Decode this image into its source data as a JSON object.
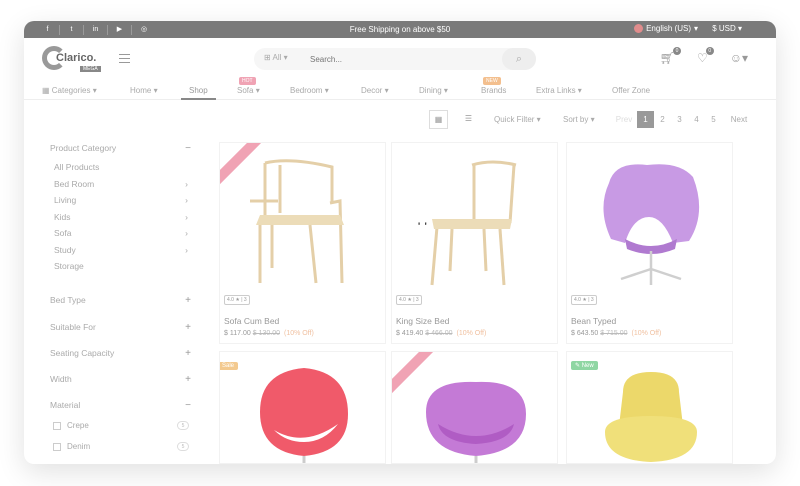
{
  "topbar": {
    "social": [
      "f",
      "t",
      "in",
      "▶",
      "◎"
    ],
    "shipping": "Free Shipping on above $50",
    "language": "English (US)",
    "currency": "$ USD"
  },
  "header": {
    "logo_text": "Clarico.",
    "logo_badge": "MEGA",
    "search_category": "All",
    "search_placeholder": "Search...",
    "cart_count": "0",
    "wishlist_count": "0"
  },
  "nav": {
    "categories": "Categories",
    "home": "Home",
    "shop": "Shop",
    "sofa": "Sofa",
    "sofa_tag": "HOT",
    "bedroom": "Bedroom",
    "decor": "Decor",
    "dining": "Dining",
    "brands": "Brands",
    "brands_tag": "NEW",
    "extra_links": "Extra Links",
    "offer_zone": "Offer Zone"
  },
  "sidebar": {
    "product_category": "Product Category",
    "categories": [
      "All Products",
      "Bed Room",
      "Living",
      "Kids",
      "Sofa",
      "Study",
      "Storage"
    ],
    "filters": [
      "Bed Type",
      "Suitable For",
      "Seating Capacity",
      "Width",
      "Material"
    ],
    "materials": [
      {
        "label": "Crepe",
        "count": "5"
      },
      {
        "label": "Denim",
        "count": "5"
      }
    ]
  },
  "toolbar": {
    "quick_filter": "Quick Filter",
    "sort_by": "Sort by",
    "prev": "Prev",
    "pages": [
      "1",
      "2",
      "3",
      "4",
      "5"
    ],
    "next": "Next"
  },
  "products": [
    {
      "name": "Sofa Cum Bed",
      "price": "$ 117.00",
      "old_price": "$ 130.00",
      "discount": "(10% Off)",
      "rating": "4.0 ★ | 3"
    },
    {
      "name": "King Size Bed",
      "price": "$ 419.40",
      "old_price": "$ 466.00",
      "discount": "(10% Off)",
      "rating": "4.0 ★ | 3"
    },
    {
      "name": "Bean Typed",
      "price": "$ 643.50",
      "old_price": "$ 715.00",
      "discount": "(10% Off)",
      "rating": "4.0 ★ | 3"
    }
  ],
  "row2_tags": {
    "sale": "Sale",
    "new": "New"
  },
  "colors": {
    "accent": "#888888",
    "hot": "#f0a3b4",
    "new": "#f3bf8e",
    "new_green": "#8fd6a3",
    "ribbon": "#f0a3b4"
  }
}
